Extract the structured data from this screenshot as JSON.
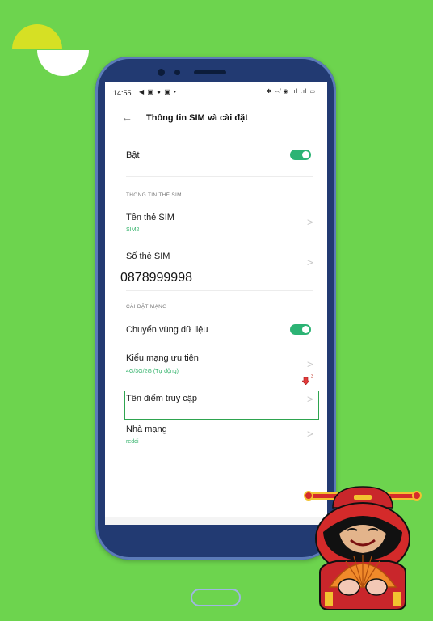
{
  "status_bar": {
    "time": "14:55",
    "notification_icons": "◀ ▣ ● ▣ •",
    "system_icons": "✱ ⇎ ◉ .ıl .ıl ▭"
  },
  "header": {
    "back_icon": "←",
    "title": "Thông tin SIM và cài đặt"
  },
  "enable_row": {
    "label": "Bật",
    "toggle_on": true
  },
  "sim_info_section": {
    "header": "THÔNG TIN THẺ SIM",
    "sim_name": {
      "label": "Tên thẻ SIM",
      "value": "SIM2"
    },
    "sim_number": {
      "label": "Số thẻ SIM",
      "value": "0878999998"
    }
  },
  "network_section": {
    "header": "CÀI ĐẶT MẠNG",
    "data_roaming": {
      "label": "Chuyển vùng dữ liệu",
      "toggle_on": true
    },
    "preferred_network": {
      "label": "Kiểu mạng ưu tiên",
      "value": "4G/3G/2G (Tự động)"
    },
    "apn": {
      "label": "Tên điểm truy cập"
    },
    "carrier": {
      "label": "Nhà mạng",
      "value": "reddi"
    }
  },
  "annotation": {
    "marker_number": "3"
  },
  "chevron_glyph": ">",
  "colors": {
    "background": "#6dd44e",
    "accent_green": "#2cb374",
    "highlight_box": "#2ea44f",
    "phone_frame": "#223a72"
  }
}
